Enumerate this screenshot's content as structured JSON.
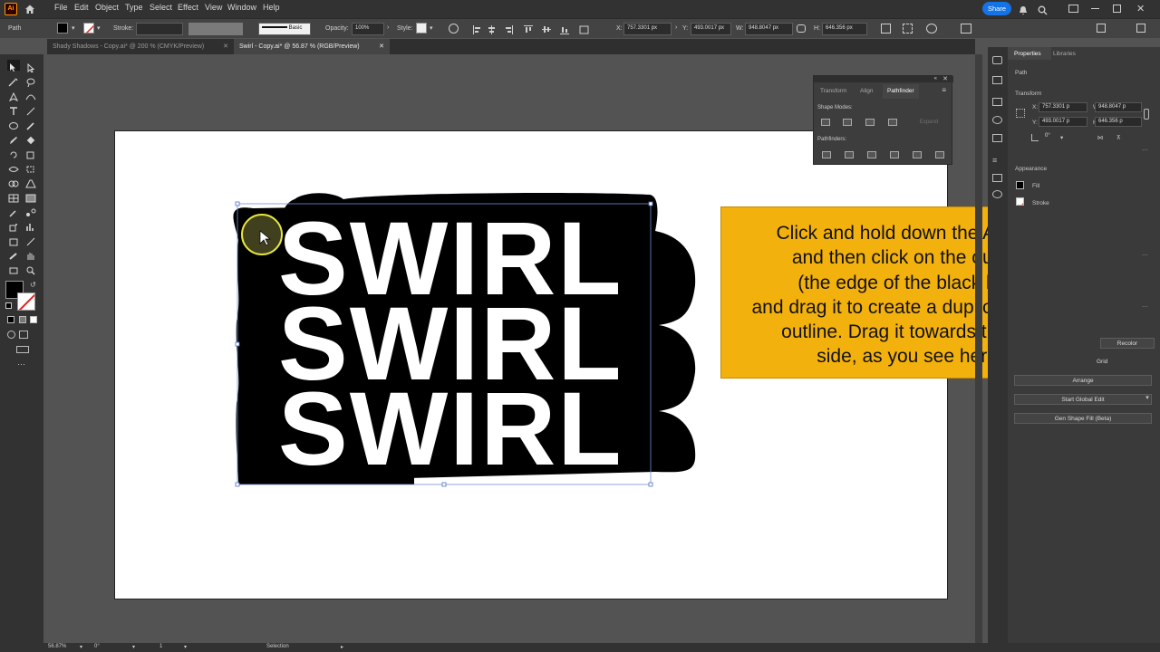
{
  "app": {
    "logo": "Ai"
  },
  "menu": {
    "items": [
      "File",
      "Edit",
      "Object",
      "Type",
      "Select",
      "Effect",
      "View",
      "Window",
      "Help"
    ],
    "share_label": "Share"
  },
  "control_bar": {
    "selection_type": "Path",
    "stroke_label": "Stroke:",
    "brush_label": "Basic",
    "opacity_label": "Opacity:",
    "opacity_value": "100%",
    "style_label": "Style:",
    "x_label": "X:",
    "x_value": "757.3301 px",
    "y_label": "Y:",
    "y_value": "493.0017 px",
    "w_label": "W:",
    "w_value": "948.8047 px",
    "h_label": "H:",
    "h_value": "646.356 px"
  },
  "tabs": [
    {
      "label": "Shady Shadows - Copy.ai* @ 200 % (CMYK/Preview)",
      "active": false
    },
    {
      "label": "Swirl - Copy.ai* @ 56.87 % (RGB/Preview)",
      "active": true
    }
  ],
  "pathfinder": {
    "tabs": [
      "Transform",
      "Align",
      "Pathfinder"
    ],
    "shape_modes_label": "Shape Modes:",
    "expand_label": "Expand",
    "pathfinders_label": "Pathfinders:"
  },
  "artwork": {
    "word": "SWIRL"
  },
  "callout": {
    "lines": [
      "Click and hold down the Alt key,",
      "and then click on the outline",
      "(the edge of the black line)",
      "and drag it to create a duplicate black",
      "outline. Drag it towards the left",
      "side, as you see here."
    ]
  },
  "right_panel": {
    "tabs": [
      "Properties",
      "Libraries"
    ],
    "object_type": "Path",
    "transform_label": "Transform",
    "x_label": "X:",
    "x_value": "757.3301 p",
    "y_label": "Y:",
    "y_value": "493.0017 p",
    "w_label": "W:",
    "w_value": "948.8047 p",
    "h_label": "H:",
    "h_value": "646.356 p",
    "angle_value": "0°",
    "appearance_label": "Appearance",
    "fill_label": "Fill",
    "stroke_label": "Stroke",
    "recolor_label": "Recolor",
    "grid_label": "Grid",
    "arrange_label": "Arrange",
    "global_edit_label": "Start Global Edit",
    "gen_shape_label": "Gen Shape Fill (Beta)"
  },
  "status_bar": {
    "zoom": "56.87%",
    "rotation": "0°",
    "artboard": "1",
    "tool": "Selection"
  },
  "colors": {
    "callout_bg": "#f3b10d",
    "share_btn": "#1473e6",
    "canvas_bg": "#535353"
  }
}
